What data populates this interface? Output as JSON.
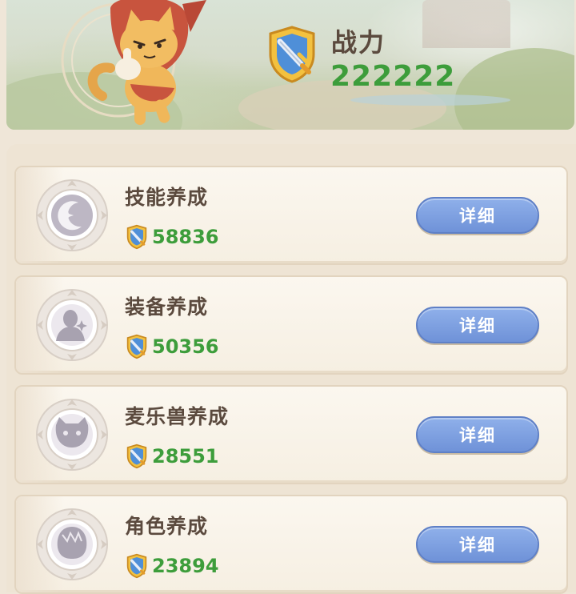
{
  "header": {
    "power_label": "战力",
    "power_value": "222222"
  },
  "icons": {
    "power": "shield-sword-icon",
    "mascot": "cat-mascot"
  },
  "colors": {
    "power_value": "#3d9d3b",
    "detail_button": "#7a9be0",
    "title_text": "#5b4a3e"
  },
  "cards": [
    {
      "title": "技能养成",
      "score": "58836",
      "button": "详细",
      "icon": "crescent-moon-star-icon"
    },
    {
      "title": "装备养成",
      "score": "50356",
      "button": "详细",
      "icon": "person-silhouette-icon"
    },
    {
      "title": "麦乐兽养成",
      "score": "28551",
      "button": "详细",
      "icon": "cat-face-icon"
    },
    {
      "title": "角色养成",
      "score": "23894",
      "button": "详细",
      "icon": "character-head-icon"
    }
  ]
}
